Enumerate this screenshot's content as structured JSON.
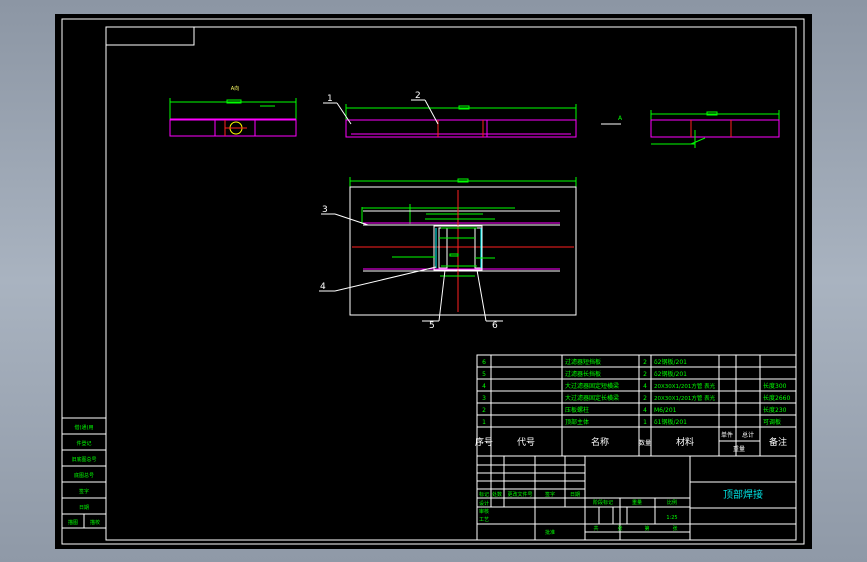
{
  "drawing": {
    "title": "顶部焊接",
    "view_label_a": "A向",
    "view_marker": "A",
    "callouts": [
      "1",
      "2",
      "3",
      "4",
      "5",
      "6"
    ]
  },
  "bom": {
    "rows": [
      {
        "no": "6",
        "name": "过滤器短挡板",
        "qty": "2",
        "material": "δ2钢板/201",
        "note": ""
      },
      {
        "no": "5",
        "name": "过滤器长挡板",
        "qty": "2",
        "material": "δ2钢板/201",
        "note": ""
      },
      {
        "no": "4",
        "name": "大过滤器固定短横梁",
        "qty": "4",
        "material": "20X30X1/201方管  表光",
        "note": "长度300"
      },
      {
        "no": "3",
        "name": "大过滤器固定长横梁",
        "qty": "2",
        "material": "20X30X1/201方管  表光",
        "note": "长度2660"
      },
      {
        "no": "2",
        "name": "压板螺柱",
        "qty": "4",
        "material": "M6/201",
        "note": "长度230"
      },
      {
        "no": "1",
        "name": "顶部主体",
        "qty": "1",
        "material": "δ1钢板/201",
        "note": "可调板"
      }
    ],
    "headers": {
      "no": "序号",
      "code": "代号",
      "name": "名称",
      "qty": "数量",
      "material": "材料",
      "unit": "单件",
      "total": "总计",
      "weight": "重量",
      "note": "备注"
    }
  },
  "title_block": {
    "labels": [
      "标记",
      "处数",
      "更改文件号",
      "签字",
      "日期",
      "设计",
      "审核",
      "工艺",
      "批准",
      "阶段标记",
      "重量",
      "比例",
      "共",
      "张",
      "第",
      "张"
    ],
    "scale": "1:25"
  },
  "side_strip": {
    "cells": [
      "借(通)用",
      "件登记",
      "旧底图总号",
      "底图总号",
      "签字",
      "日期",
      "描图",
      "描校"
    ]
  }
}
